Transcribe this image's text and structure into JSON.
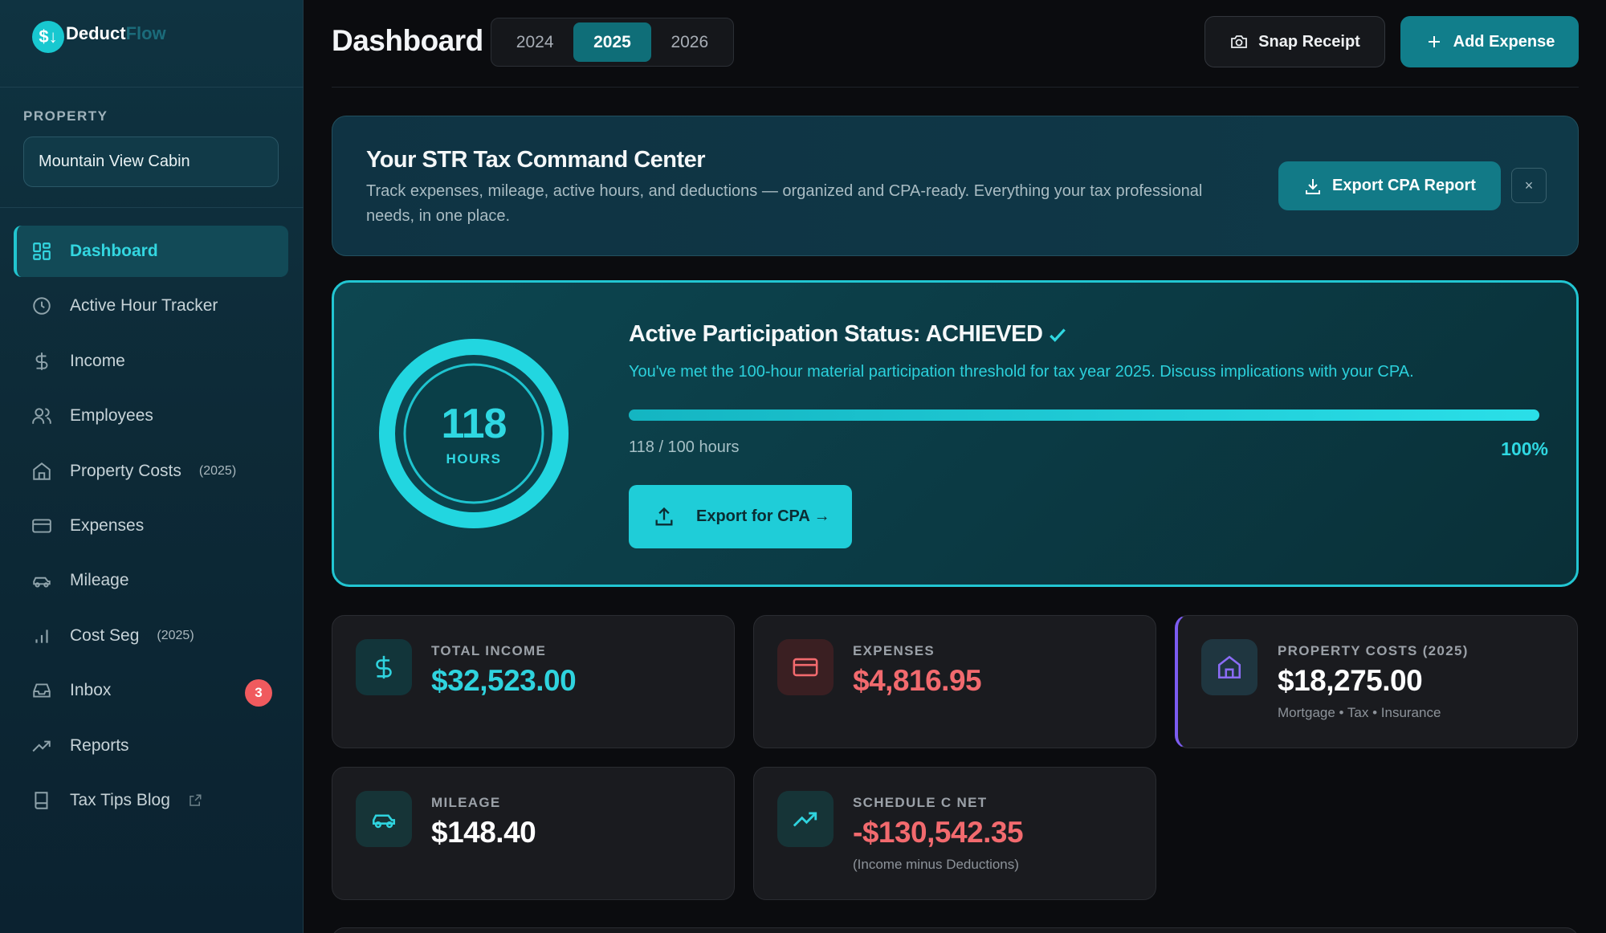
{
  "brand": {
    "logo_glyph": "$↓",
    "name_part1": "Deduct",
    "name_part2": "Flow"
  },
  "sidebar": {
    "property_label": "PROPERTY",
    "property_value": "Mountain View Cabin",
    "items": [
      {
        "label": "Dashboard",
        "icon": "grid-icon",
        "active": true
      },
      {
        "label": "Active Hour Tracker",
        "icon": "clock-icon"
      },
      {
        "label": "Income",
        "icon": "dollar-icon"
      },
      {
        "label": "Employees",
        "icon": "users-icon"
      },
      {
        "label": "Property Costs",
        "tag": "(2025)",
        "icon": "home-icon"
      },
      {
        "label": "Expenses",
        "icon": "credit-card-icon"
      },
      {
        "label": "Mileage",
        "icon": "car-icon"
      },
      {
        "label": "Cost Seg",
        "tag": "(2025)",
        "icon": "bar-chart-icon"
      },
      {
        "label": "Inbox",
        "badge": "3",
        "icon": "inbox-icon"
      },
      {
        "label": "Reports",
        "icon": "trending-up-icon"
      },
      {
        "label": "Tax Tips Blog",
        "icon": "book-icon",
        "external": true
      }
    ]
  },
  "header": {
    "title": "Dashboard",
    "years": [
      "2024",
      "2025",
      "2026"
    ],
    "selected_year": "2025",
    "snap_receipt_label": "Snap Receipt",
    "add_expense_label": "Add Expense"
  },
  "banner": {
    "title": "Your STR Tax Command Center",
    "description": "Track expenses, mileage, active hours, and deductions — organized and CPA-ready. Everything your tax professional needs, in one place.",
    "export_label": "Export CPA Report",
    "close_glyph": "×"
  },
  "participation": {
    "hours_value": "118",
    "hours_unit": "HOURS",
    "title": "Active Participation Status: ACHIEVED",
    "message": "You've met the 100-hour material participation threshold for tax year 2025. Discuss implications with your CPA.",
    "progress_fraction": 1.0,
    "progress_text": "118 / 100 hours",
    "progress_percent": "100%",
    "export_label": "Export for CPA →"
  },
  "stats": {
    "income": {
      "label": "TOTAL INCOME",
      "value": "$32,523.00",
      "color": "#2fd3de"
    },
    "expenses": {
      "label": "EXPENSES",
      "value": "$4,816.95",
      "color": "#f26a6e"
    },
    "property_costs": {
      "label": "PROPERTY COSTS (2025)",
      "value": "$18,275.00",
      "sub": "Mortgage • Tax • Insurance",
      "color": "#ffffff"
    },
    "mileage": {
      "label": "MILEAGE",
      "value": "$148.40",
      "color": "#ffffff"
    },
    "schedule_c": {
      "label": "SCHEDULE C NET",
      "value": "-$130,542.35",
      "sub": "(Income minus Deductions)",
      "color": "#f26a6e"
    }
  },
  "colors": {
    "accent": "#22c6d2",
    "danger": "#f05a5e",
    "purple": "#7c5cf0"
  }
}
